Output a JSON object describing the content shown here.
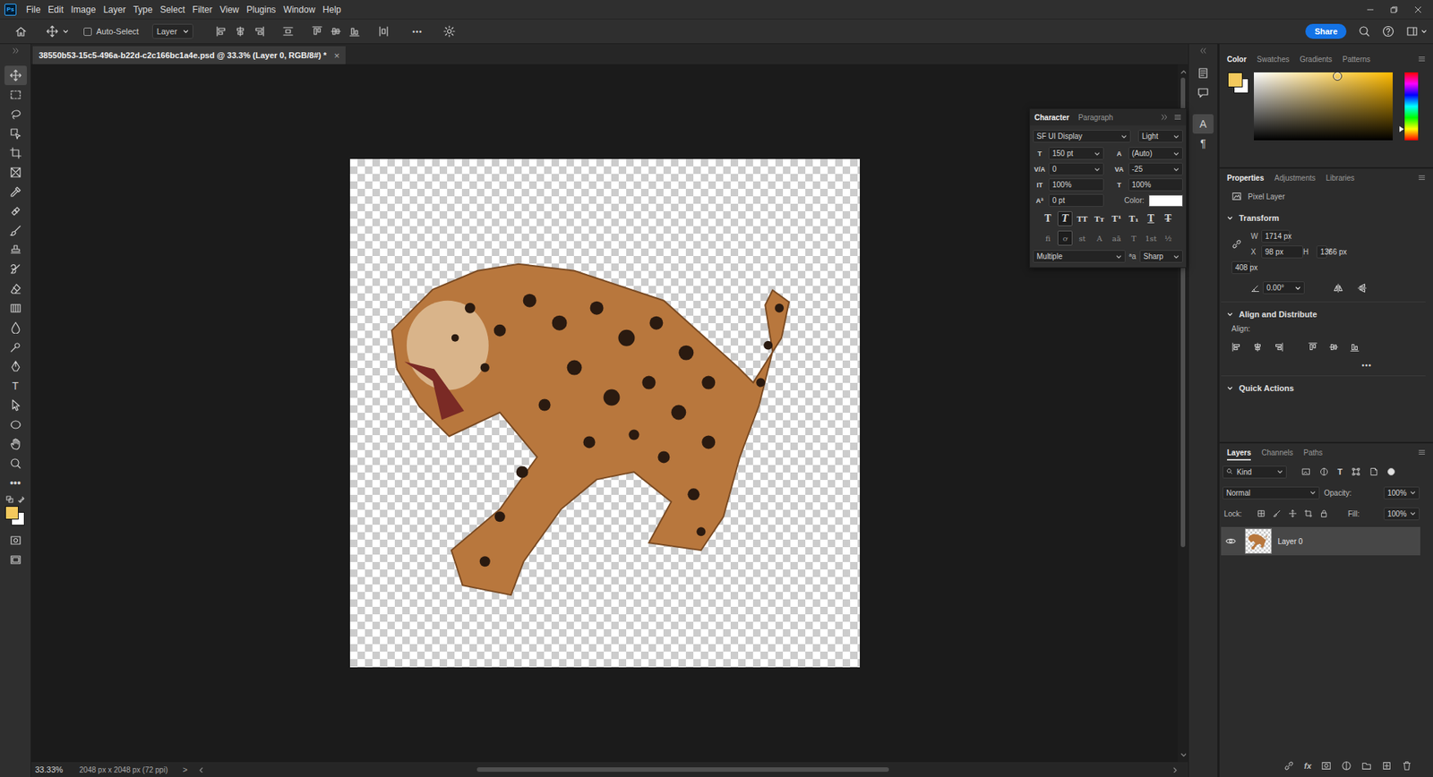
{
  "app": {
    "logo": "Ps"
  },
  "menu": [
    "File",
    "Edit",
    "Image",
    "Layer",
    "Type",
    "Select",
    "Filter",
    "View",
    "Plugins",
    "Window",
    "Help"
  ],
  "options_bar": {
    "auto_select": {
      "label": "Auto-Select",
      "checked": false
    },
    "target": "Layer",
    "more": "•••",
    "share": "Share"
  },
  "document_tab": {
    "title": "38550b53-15c5-496a-b22d-c2c166bc1a4e.psd @ 33.3% (Layer 0, RGB/8#) *",
    "close": "×",
    "selected": true
  },
  "tools": [
    {
      "kind": "icon",
      "selected": true
    },
    {
      "kind": "icon",
      "selected": false
    },
    {
      "kind": "icon",
      "selected": false
    },
    {
      "kind": "icon",
      "selected": false
    },
    {
      "kind": "icon",
      "selected": false
    },
    {
      "kind": "icon",
      "selected": false
    },
    {
      "kind": "icon",
      "selected": false
    },
    {
      "kind": "icon",
      "selected": false
    },
    {
      "kind": "icon",
      "selected": false
    },
    {
      "kind": "icon",
      "selected": false
    },
    {
      "kind": "icon",
      "selected": false
    },
    {
      "kind": "icon",
      "selected": false
    },
    {
      "kind": "icon",
      "selected": false
    },
    {
      "kind": "icon",
      "selected": false
    },
    {
      "kind": "icon",
      "selected": false
    },
    {
      "kind": "icon",
      "selected": false
    },
    {
      "kind": "glyph",
      "label": "T",
      "selected": false
    },
    {
      "kind": "icon",
      "selected": false
    },
    {
      "kind": "icon",
      "selected": false
    },
    {
      "kind": "icon",
      "selected": false
    },
    {
      "kind": "icon",
      "selected": false
    },
    {
      "kind": "glyph",
      "label": "•••",
      "selected": false
    }
  ],
  "swatches": {
    "foreground": "#f4c95d",
    "background": "#ffffff"
  },
  "character_panel": {
    "tabs": [
      {
        "label": "Character",
        "selected": true
      },
      {
        "label": "Paragraph",
        "selected": false
      }
    ],
    "font_family": "SF UI Display",
    "font_style": "Light",
    "fields": [
      {
        "icon": "T",
        "value": "150 pt",
        "kind": "dropdown"
      },
      {
        "icon": "A",
        "value": "(Auto)",
        "kind": "dropdown"
      },
      {
        "icon": "V/A",
        "value": "0",
        "kind": "dropdown"
      },
      {
        "icon": "VA",
        "value": "-25",
        "kind": "dropdown"
      },
      {
        "icon": "IT",
        "value": "100%",
        "kind": "input"
      },
      {
        "icon": "T",
        "value": "100%",
        "kind": "input"
      },
      {
        "icon": "Aª",
        "value": "0 pt",
        "kind": "input"
      }
    ],
    "color_label": "Color:",
    "color": "#ffffff",
    "type_buttons": [
      {
        "label": "T",
        "kind": "bold",
        "selected": false
      },
      {
        "label": "T",
        "kind": "italic",
        "selected": true
      },
      {
        "label": "TT",
        "kind": "caps",
        "selected": false
      },
      {
        "label": "Tт",
        "kind": "smallcaps",
        "selected": false
      },
      {
        "label": "T¹",
        "kind": "super",
        "selected": false
      },
      {
        "label": "T₁",
        "kind": "sub",
        "selected": false
      },
      {
        "label": "T",
        "kind": "underline",
        "selected": false
      },
      {
        "label": "T",
        "kind": "strike",
        "selected": false
      }
    ],
    "opentype_buttons": [
      {
        "label": "fi",
        "selected": false
      },
      {
        "label": "ơ",
        "selected": true
      },
      {
        "label": "st",
        "selected": false
      },
      {
        "label": "A",
        "selected": false
      },
      {
        "label": "aā",
        "selected": false
      },
      {
        "label": "T",
        "selected": false
      },
      {
        "label": "1st",
        "selected": false
      },
      {
        "label": "½",
        "selected": false
      }
    ],
    "language": "Multiple",
    "antialias_icon": "ªa",
    "antialias": "Sharp"
  },
  "icon_strip": [
    {
      "kind": "icon",
      "selected": false
    },
    {
      "kind": "icon",
      "selected": false
    },
    {
      "kind": "glyph",
      "label": "A",
      "selected": true
    },
    {
      "kind": "glyph",
      "label": "¶",
      "selected": false
    }
  ],
  "color_panel": {
    "tabs": [
      {
        "label": "Color",
        "selected": true
      },
      {
        "label": "Swatches",
        "selected": false
      },
      {
        "label": "Gradients",
        "selected": false
      },
      {
        "label": "Patterns",
        "selected": false
      }
    ],
    "hue_color": "#ffbb00",
    "saturation": 0.6,
    "brightness": 0.95,
    "hue_level": 0.83
  },
  "properties_panel": {
    "tabs": [
      {
        "label": "Properties",
        "selected": true
      },
      {
        "label": "Adjustments",
        "selected": false
      },
      {
        "label": "Libraries",
        "selected": false
      }
    ],
    "layer_kind": "Pixel Layer",
    "transform": {
      "title": "Transform",
      "expanded": true,
      "fields": [
        {
          "label": "W",
          "value": "1714 px"
        },
        {
          "label": "X",
          "value": "98 px"
        },
        {
          "label": "H",
          "value": "1366 px"
        },
        {
          "label": "Y",
          "value": "408 px"
        }
      ],
      "angle": "0.00°"
    },
    "align": {
      "title": "Align and Distribute",
      "expanded": true,
      "label": "Align:",
      "more": "•••"
    },
    "quick_actions": {
      "title": "Quick Actions",
      "expanded": true
    }
  },
  "layers_panel": {
    "tabs": [
      {
        "label": "Layers",
        "selected": true
      },
      {
        "label": "Channels",
        "selected": false
      },
      {
        "label": "Paths",
        "selected": false
      }
    ],
    "filter": {
      "label": "Kind",
      "type_glyph": "T",
      "on": true
    },
    "blend_mode": "Normal",
    "opacity_label": "Opacity:",
    "opacity": "100%",
    "lock_label": "Lock:",
    "fill_label": "Fill:",
    "fill": "100%",
    "layers": [
      {
        "name": "Layer 0",
        "visible": true,
        "selected": true
      }
    ],
    "footer_fx": "fx"
  },
  "status_bar": {
    "zoom": "33.33%",
    "document": "2048 px x 2048 px (72 ppi)",
    "menu_arrow": ">"
  },
  "scrollbars": {
    "vertical": {
      "offset": 0.0,
      "level": 0.7
    },
    "horizontal": {
      "offset": 0.28,
      "level": 0.43
    }
  }
}
